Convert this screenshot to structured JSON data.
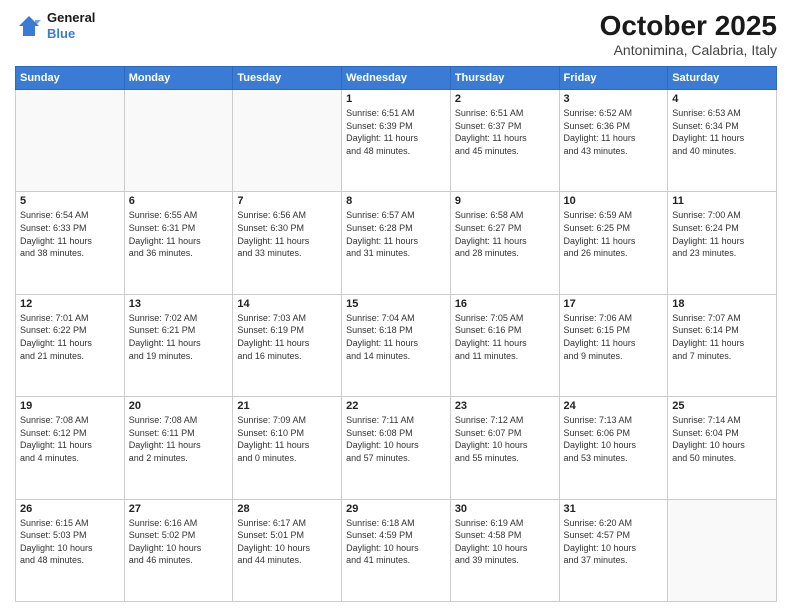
{
  "logo": {
    "line1": "General",
    "line2": "Blue"
  },
  "title": "October 2025",
  "subtitle": "Antonimina, Calabria, Italy",
  "days_of_week": [
    "Sunday",
    "Monday",
    "Tuesday",
    "Wednesday",
    "Thursday",
    "Friday",
    "Saturday"
  ],
  "weeks": [
    [
      {
        "day": "",
        "info": ""
      },
      {
        "day": "",
        "info": ""
      },
      {
        "day": "",
        "info": ""
      },
      {
        "day": "1",
        "info": "Sunrise: 6:51 AM\nSunset: 6:39 PM\nDaylight: 11 hours\nand 48 minutes."
      },
      {
        "day": "2",
        "info": "Sunrise: 6:51 AM\nSunset: 6:37 PM\nDaylight: 11 hours\nand 45 minutes."
      },
      {
        "day": "3",
        "info": "Sunrise: 6:52 AM\nSunset: 6:36 PM\nDaylight: 11 hours\nand 43 minutes."
      },
      {
        "day": "4",
        "info": "Sunrise: 6:53 AM\nSunset: 6:34 PM\nDaylight: 11 hours\nand 40 minutes."
      }
    ],
    [
      {
        "day": "5",
        "info": "Sunrise: 6:54 AM\nSunset: 6:33 PM\nDaylight: 11 hours\nand 38 minutes."
      },
      {
        "day": "6",
        "info": "Sunrise: 6:55 AM\nSunset: 6:31 PM\nDaylight: 11 hours\nand 36 minutes."
      },
      {
        "day": "7",
        "info": "Sunrise: 6:56 AM\nSunset: 6:30 PM\nDaylight: 11 hours\nand 33 minutes."
      },
      {
        "day": "8",
        "info": "Sunrise: 6:57 AM\nSunset: 6:28 PM\nDaylight: 11 hours\nand 31 minutes."
      },
      {
        "day": "9",
        "info": "Sunrise: 6:58 AM\nSunset: 6:27 PM\nDaylight: 11 hours\nand 28 minutes."
      },
      {
        "day": "10",
        "info": "Sunrise: 6:59 AM\nSunset: 6:25 PM\nDaylight: 11 hours\nand 26 minutes."
      },
      {
        "day": "11",
        "info": "Sunrise: 7:00 AM\nSunset: 6:24 PM\nDaylight: 11 hours\nand 23 minutes."
      }
    ],
    [
      {
        "day": "12",
        "info": "Sunrise: 7:01 AM\nSunset: 6:22 PM\nDaylight: 11 hours\nand 21 minutes."
      },
      {
        "day": "13",
        "info": "Sunrise: 7:02 AM\nSunset: 6:21 PM\nDaylight: 11 hours\nand 19 minutes."
      },
      {
        "day": "14",
        "info": "Sunrise: 7:03 AM\nSunset: 6:19 PM\nDaylight: 11 hours\nand 16 minutes."
      },
      {
        "day": "15",
        "info": "Sunrise: 7:04 AM\nSunset: 6:18 PM\nDaylight: 11 hours\nand 14 minutes."
      },
      {
        "day": "16",
        "info": "Sunrise: 7:05 AM\nSunset: 6:16 PM\nDaylight: 11 hours\nand 11 minutes."
      },
      {
        "day": "17",
        "info": "Sunrise: 7:06 AM\nSunset: 6:15 PM\nDaylight: 11 hours\nand 9 minutes."
      },
      {
        "day": "18",
        "info": "Sunrise: 7:07 AM\nSunset: 6:14 PM\nDaylight: 11 hours\nand 7 minutes."
      }
    ],
    [
      {
        "day": "19",
        "info": "Sunrise: 7:08 AM\nSunset: 6:12 PM\nDaylight: 11 hours\nand 4 minutes."
      },
      {
        "day": "20",
        "info": "Sunrise: 7:08 AM\nSunset: 6:11 PM\nDaylight: 11 hours\nand 2 minutes."
      },
      {
        "day": "21",
        "info": "Sunrise: 7:09 AM\nSunset: 6:10 PM\nDaylight: 11 hours\nand 0 minutes."
      },
      {
        "day": "22",
        "info": "Sunrise: 7:11 AM\nSunset: 6:08 PM\nDaylight: 10 hours\nand 57 minutes."
      },
      {
        "day": "23",
        "info": "Sunrise: 7:12 AM\nSunset: 6:07 PM\nDaylight: 10 hours\nand 55 minutes."
      },
      {
        "day": "24",
        "info": "Sunrise: 7:13 AM\nSunset: 6:06 PM\nDaylight: 10 hours\nand 53 minutes."
      },
      {
        "day": "25",
        "info": "Sunrise: 7:14 AM\nSunset: 6:04 PM\nDaylight: 10 hours\nand 50 minutes."
      }
    ],
    [
      {
        "day": "26",
        "info": "Sunrise: 6:15 AM\nSunset: 5:03 PM\nDaylight: 10 hours\nand 48 minutes."
      },
      {
        "day": "27",
        "info": "Sunrise: 6:16 AM\nSunset: 5:02 PM\nDaylight: 10 hours\nand 46 minutes."
      },
      {
        "day": "28",
        "info": "Sunrise: 6:17 AM\nSunset: 5:01 PM\nDaylight: 10 hours\nand 44 minutes."
      },
      {
        "day": "29",
        "info": "Sunrise: 6:18 AM\nSunset: 4:59 PM\nDaylight: 10 hours\nand 41 minutes."
      },
      {
        "day": "30",
        "info": "Sunrise: 6:19 AM\nSunset: 4:58 PM\nDaylight: 10 hours\nand 39 minutes."
      },
      {
        "day": "31",
        "info": "Sunrise: 6:20 AM\nSunset: 4:57 PM\nDaylight: 10 hours\nand 37 minutes."
      },
      {
        "day": "",
        "info": ""
      }
    ]
  ]
}
